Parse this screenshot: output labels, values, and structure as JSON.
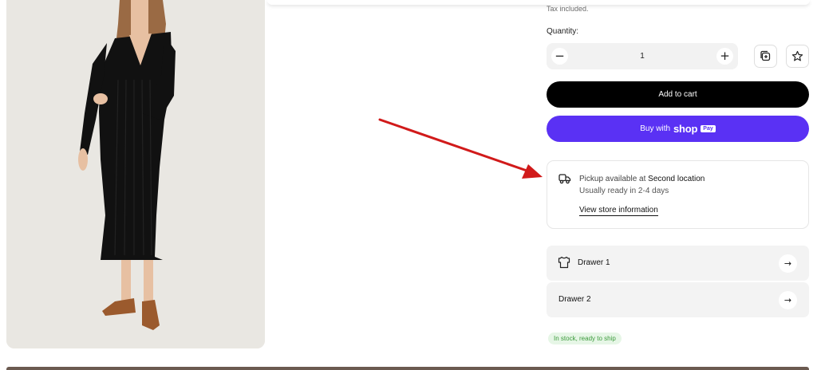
{
  "product": {
    "tax_note": "Tax included.",
    "quantity_label": "Quantity:",
    "quantity_value": "1",
    "minus_symbol": "−",
    "plus_symbol": "+"
  },
  "actions": {
    "add_to_cart_label": "Add to cart",
    "buy_with_label": "Buy with",
    "shop_brand": "shop",
    "pay_badge": "Pay"
  },
  "pickup": {
    "prefix": "Pickup available at",
    "location": "Second location",
    "ready_text": "Usually ready in 2-4 days",
    "link_label": "View store information"
  },
  "drawers": [
    {
      "label": "Drawer 1",
      "icon": "shirt-icon",
      "arrow": "→"
    },
    {
      "label": "Drawer 2",
      "arrow": "→"
    }
  ],
  "stock": {
    "label": "In stock, ready to ship"
  },
  "colors": {
    "accent_black": "#000000",
    "shop_pay_purple": "#5a31f4",
    "stock_green": "#3c9a3c",
    "annotation_red": "#d11a1a",
    "dress_black": "#111111"
  }
}
